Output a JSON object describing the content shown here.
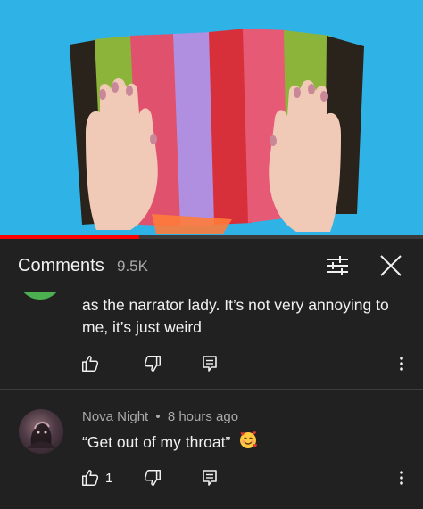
{
  "video": {
    "progress_percent": 33,
    "colors": {
      "background": "#2fb3e6",
      "progress": "#ff0000"
    }
  },
  "header": {
    "title": "Comments",
    "count": "9.5K",
    "filter_icon": "sliders-icon",
    "close_icon": "close-icon"
  },
  "comments": [
    {
      "text_visible": "as the narrator lady. It’s not very annoying to me, it’s just weird",
      "actions": {
        "like_icon": "thumb-up-icon",
        "dislike_icon": "thumb-down-icon",
        "reply_icon": "reply-icon",
        "more_icon": "more-vertical-icon"
      }
    },
    {
      "author": "Nova Night",
      "separator": "•",
      "time": "8 hours ago",
      "text": "“Get out of my throat”",
      "emoji": "🥰",
      "likes": "1",
      "actions": {
        "like_icon": "thumb-up-icon",
        "dislike_icon": "thumb-down-icon",
        "reply_icon": "reply-icon",
        "more_icon": "more-vertical-icon"
      }
    }
  ]
}
